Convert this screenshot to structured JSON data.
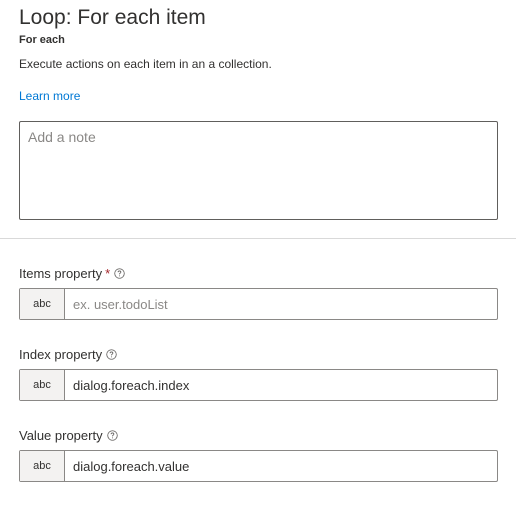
{
  "header": {
    "title": "Loop: For each item",
    "subtitle": "For each",
    "description": "Execute actions on each item in an a collection.",
    "learn_more": "Learn more"
  },
  "note": {
    "placeholder": "Add a note",
    "value": ""
  },
  "fields": {
    "items": {
      "label": "Items property",
      "required_mark": "*",
      "type": "abc",
      "value": "",
      "placeholder": "ex. user.todoList"
    },
    "index": {
      "label": "Index property",
      "type": "abc",
      "value": "dialog.foreach.index",
      "placeholder": ""
    },
    "value": {
      "label": "Value property",
      "type": "abc",
      "value": "dialog.foreach.value",
      "placeholder": ""
    }
  },
  "icons": {
    "help": "help-circle-icon"
  },
  "colors": {
    "link": "#0078d4",
    "required": "#a4262c",
    "text": "#323130",
    "prefix_bg": "#f3f2f1"
  }
}
